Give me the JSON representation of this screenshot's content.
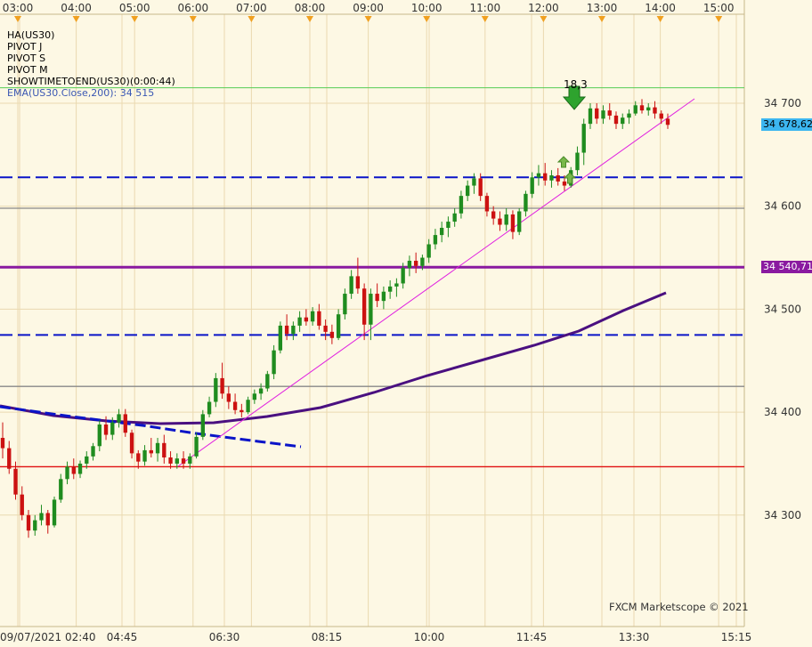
{
  "window": {
    "indicators": [
      "HA(US30)",
      "PIVOT J",
      "PIVOT S",
      "PIVOT M",
      "SHOWTIMETOEND(US30)(0:00:44)",
      "EMA(US30.Close,200): 34 515"
    ],
    "credit": "FXCM Marketscope © 2021",
    "price_badge": "34 678,62",
    "pivot_badge": "34 540,71",
    "annotation": "18,3"
  },
  "colors": {
    "background": "#fdf8e4",
    "grid": "#ead9b0",
    "bull": "#1f8c1f",
    "bear": "#cc1111",
    "pivot_j": "#8a1aa0",
    "pivot_dashed": "#0a14c8",
    "ema": "#4a1080",
    "trend_line": "#e020e0",
    "red_line": "#e01010",
    "price_badge": "#3cb6f0",
    "pivot_badge": "#8a1aa0"
  },
  "chart_data": {
    "type": "candlestick",
    "symbol": "US30",
    "top_time_labels": [
      "03:00",
      "04:00",
      "05:00",
      "06:00",
      "07:00",
      "08:00",
      "09:00",
      "10:00",
      "11:00",
      "12:00",
      "13:00",
      "14:00",
      "15:00"
    ],
    "bottom_time_labels": [
      "09/07/2021 02:40",
      "04:45",
      "06:30",
      "08:15",
      "10:00",
      "11:45",
      "13:30",
      "15:15"
    ],
    "price_labels": [
      "34 700",
      "34 600",
      "34 500",
      "34 400",
      "34 300"
    ],
    "price_range": [
      34190,
      34765
    ],
    "current_price": 34678.62,
    "pivot_levels": [
      {
        "name": "PIVOT J",
        "value": 34540.71,
        "style": "solid",
        "color": "#8a1aa0"
      },
      {
        "name": "dashed-upper",
        "value": 34628,
        "style": "dashed",
        "color": "#0a14c8"
      },
      {
        "name": "dashed-lower",
        "value": 34475,
        "style": "dashed",
        "color": "#0a14c8"
      },
      {
        "name": "gray-upper",
        "value": 34598,
        "style": "solid",
        "color": "#888888"
      },
      {
        "name": "gray-lower",
        "value": 34425,
        "style": "solid",
        "color": "#888888"
      },
      {
        "name": "red-level",
        "value": 34347,
        "style": "solid",
        "color": "#e01010"
      },
      {
        "name": "green-level",
        "value": 34715,
        "style": "solid",
        "color": "#55cc55"
      }
    ],
    "ema": {
      "name": "EMA(US30.Close,200)",
      "value": 34515
    },
    "candles": [
      [
        34375,
        34390,
        34355,
        34365
      ],
      [
        34365,
        34372,
        34340,
        34345
      ],
      [
        34345,
        34352,
        34315,
        34320
      ],
      [
        34320,
        34328,
        34295,
        34300
      ],
      [
        34300,
        34305,
        34278,
        34285
      ],
      [
        34285,
        34300,
        34280,
        34295
      ],
      [
        34295,
        34310,
        34290,
        34302
      ],
      [
        34302,
        34305,
        34282,
        34290
      ],
      [
        34290,
        34318,
        34288,
        34315
      ],
      [
        34315,
        34340,
        34312,
        34335
      ],
      [
        34335,
        34352,
        34330,
        34347
      ],
      [
        34347,
        34355,
        34335,
        34340
      ],
      [
        34340,
        34353,
        34336,
        34350
      ],
      [
        34350,
        34362,
        34345,
        34357
      ],
      [
        34357,
        34370,
        34353,
        34367
      ],
      [
        34367,
        34392,
        34362,
        34388
      ],
      [
        34388,
        34396,
        34373,
        34378
      ],
      [
        34378,
        34395,
        34373,
        34390
      ],
      [
        34390,
        34403,
        34385,
        34398
      ],
      [
        34398,
        34403,
        34376,
        34380
      ],
      [
        34380,
        34383,
        34355,
        34360
      ],
      [
        34360,
        34363,
        34345,
        34352
      ],
      [
        34352,
        34368,
        34348,
        34363
      ],
      [
        34363,
        34375,
        34356,
        34360
      ],
      [
        34360,
        34375,
        34352,
        34370
      ],
      [
        34370,
        34378,
        34350,
        34356
      ],
      [
        34356,
        34362,
        34345,
        34350
      ],
      [
        34350,
        34360,
        34345,
        34355
      ],
      [
        34355,
        34362,
        34345,
        34350
      ],
      [
        34350,
        34360,
        34345,
        34357
      ],
      [
        34357,
        34380,
        34355,
        34376
      ],
      [
        34376,
        34402,
        34373,
        34398
      ],
      [
        34398,
        34415,
        34395,
        34410
      ],
      [
        34410,
        34438,
        34405,
        34433
      ],
      [
        34433,
        34448,
        34413,
        34418
      ],
      [
        34418,
        34425,
        34403,
        34410
      ],
      [
        34410,
        34418,
        34398,
        34402
      ],
      [
        34402,
        34408,
        34395,
        34400
      ],
      [
        34400,
        34415,
        34398,
        34412
      ],
      [
        34412,
        34422,
        34408,
        34418
      ],
      [
        34418,
        34428,
        34412,
        34423
      ],
      [
        34423,
        34440,
        34420,
        34437
      ],
      [
        34437,
        34465,
        34432,
        34460
      ],
      [
        34460,
        34488,
        34457,
        34484
      ],
      [
        34484,
        34495,
        34470,
        34476
      ],
      [
        34476,
        34488,
        34470,
        34484
      ],
      [
        34484,
        34498,
        34478,
        34492
      ],
      [
        34492,
        34500,
        34484,
        34488
      ],
      [
        34488,
        34502,
        34484,
        34498
      ],
      [
        34498,
        34505,
        34480,
        34484
      ],
      [
        34484,
        34490,
        34470,
        34478
      ],
      [
        34478,
        34485,
        34466,
        34472
      ],
      [
        34472,
        34500,
        34470,
        34495
      ],
      [
        34495,
        34520,
        34490,
        34515
      ],
      [
        34515,
        34538,
        34510,
        34532
      ],
      [
        34532,
        34550,
        34515,
        34520
      ],
      [
        34520,
        34525,
        34470,
        34485
      ],
      [
        34485,
        34520,
        34470,
        34515
      ],
      [
        34515,
        34525,
        34502,
        34508
      ],
      [
        34508,
        34522,
        34500,
        34517
      ],
      [
        34517,
        34528,
        34510,
        34522
      ],
      [
        34522,
        34530,
        34512,
        34525
      ],
      [
        34525,
        34545,
        34520,
        34540
      ],
      [
        34540,
        34552,
        34532,
        34547
      ],
      [
        34547,
        34555,
        34535,
        34542
      ],
      [
        34542,
        34553,
        34538,
        34550
      ],
      [
        34550,
        34568,
        34545,
        34563
      ],
      [
        34563,
        34578,
        34558,
        34572
      ],
      [
        34572,
        34585,
        34565,
        34579
      ],
      [
        34579,
        34590,
        34570,
        34585
      ],
      [
        34585,
        34598,
        34580,
        34593
      ],
      [
        34593,
        34615,
        34588,
        34610
      ],
      [
        34610,
        34625,
        34605,
        34620
      ],
      [
        34620,
        34632,
        34612,
        34627
      ],
      [
        34627,
        34632,
        34605,
        34610
      ],
      [
        34610,
        34613,
        34590,
        34595
      ],
      [
        34595,
        34600,
        34582,
        34588
      ],
      [
        34588,
        34595,
        34576,
        34582
      ],
      [
        34582,
        34598,
        34576,
        34592
      ],
      [
        34592,
        34596,
        34568,
        34575
      ],
      [
        34575,
        34598,
        34572,
        34595
      ],
      [
        34595,
        34615,
        34590,
        34612
      ],
      [
        34612,
        34633,
        34608,
        34628
      ],
      [
        34628,
        34640,
        34620,
        34632
      ],
      [
        34632,
        34642,
        34620,
        34625
      ],
      [
        34625,
        34635,
        34618,
        34630
      ],
      [
        34630,
        34637,
        34620,
        34624
      ],
      [
        34624,
        34630,
        34615,
        34620
      ],
      [
        34620,
        34638,
        34618,
        34635
      ],
      [
        34635,
        34658,
        34630,
        34652
      ],
      [
        34652,
        34685,
        34640,
        34680
      ],
      [
        34680,
        34700,
        34675,
        34695
      ],
      [
        34695,
        34700,
        34680,
        34685
      ],
      [
        34685,
        34698,
        34680,
        34693
      ],
      [
        34693,
        34700,
        34684,
        34688
      ],
      [
        34688,
        34692,
        34675,
        34680
      ],
      [
        34680,
        34690,
        34675,
        34686
      ],
      [
        34686,
        34694,
        34680,
        34690
      ],
      [
        34690,
        34702,
        34688,
        34698
      ],
      [
        34698,
        34704,
        34690,
        34693
      ],
      [
        34693,
        34700,
        34688,
        34696
      ],
      [
        34696,
        34702,
        34685,
        34690
      ],
      [
        34690,
        34693,
        34680,
        34685
      ],
      [
        34685,
        34690,
        34675,
        34679
      ]
    ]
  }
}
